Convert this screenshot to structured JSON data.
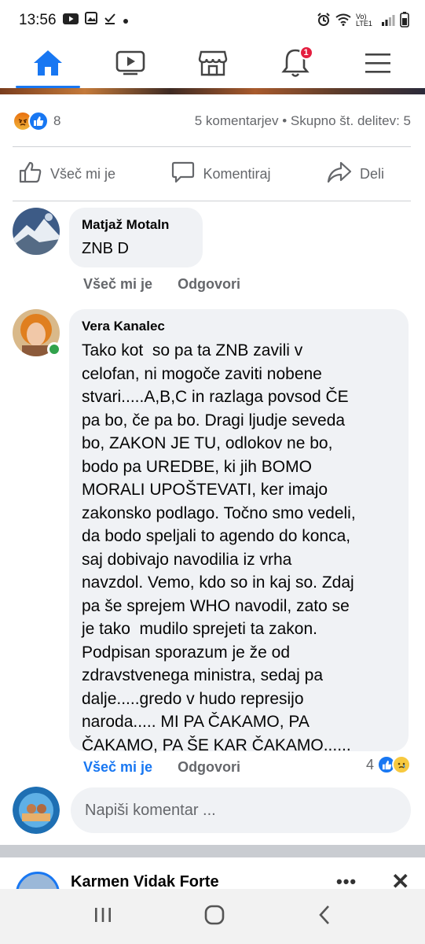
{
  "status_bar": {
    "time": "13:56",
    "network": "Vo) LTE1"
  },
  "nav": {
    "items": [
      {
        "name": "home",
        "active": true
      },
      {
        "name": "watch",
        "active": false
      },
      {
        "name": "marketplace",
        "active": false
      },
      {
        "name": "notifications",
        "active": false,
        "badge": "1"
      },
      {
        "name": "menu",
        "active": false
      }
    ],
    "accent": "#1877f2"
  },
  "post": {
    "reaction_count": "8",
    "meta": "5 komentarjev • Skupno št. delitev: 5",
    "actions": {
      "like": "Všeč mi je",
      "comment": "Komentiraj",
      "share": "Deli"
    }
  },
  "comments": [
    {
      "author": "Matjaž Motaln",
      "text": "ZNB D",
      "like_label": "Všeč mi je",
      "reply_label": "Odgovori"
    },
    {
      "author": "Vera Kanalec",
      "lines": [
        "Tako kot  so pa ta ZNB zavili v",
        "celofan, ni mogoče zaviti nobene",
        "stvari.....A,B,C in razlaga povsod ČE",
        "pa bo, če pa bo. Dragi ljudje seveda",
        "bo, ZAKON JE TU, odlokov ne bo,",
        "bodo pa UREDBE, ki jih BOMO",
        "MORALI UPOŠTEVATI, ker imajo",
        "zakonsko podlago. Točno smo vedeli,",
        "da bodo speljali to agendo do konca,",
        "saj dobivajo navodilia iz vrha",
        "navzdol. Vemo, kdo so in kaj so. Zdaj",
        "pa še sprejem WHO navodil, zato se",
        "je tako  mudilo sprejeti ta zakon.",
        "Podpisan sporazum je že od",
        "zdravstvenega ministra, sedaj pa",
        "dalje.....gredo v hudo represijo",
        "naroda..... MI PA ČAKAMO, PA",
        "ČAKAMO, PA ŠE KAR ČAKAMO......"
      ],
      "like_label": "Všeč mi je",
      "reply_label": "Odgovori",
      "reaction_count": "4",
      "online": true
    }
  ],
  "write_comment": {
    "placeholder": "Napiši komentar ..."
  },
  "next_post": {
    "author": "Karmen Vidak Forte",
    "more": "•••",
    "close": "✕"
  }
}
